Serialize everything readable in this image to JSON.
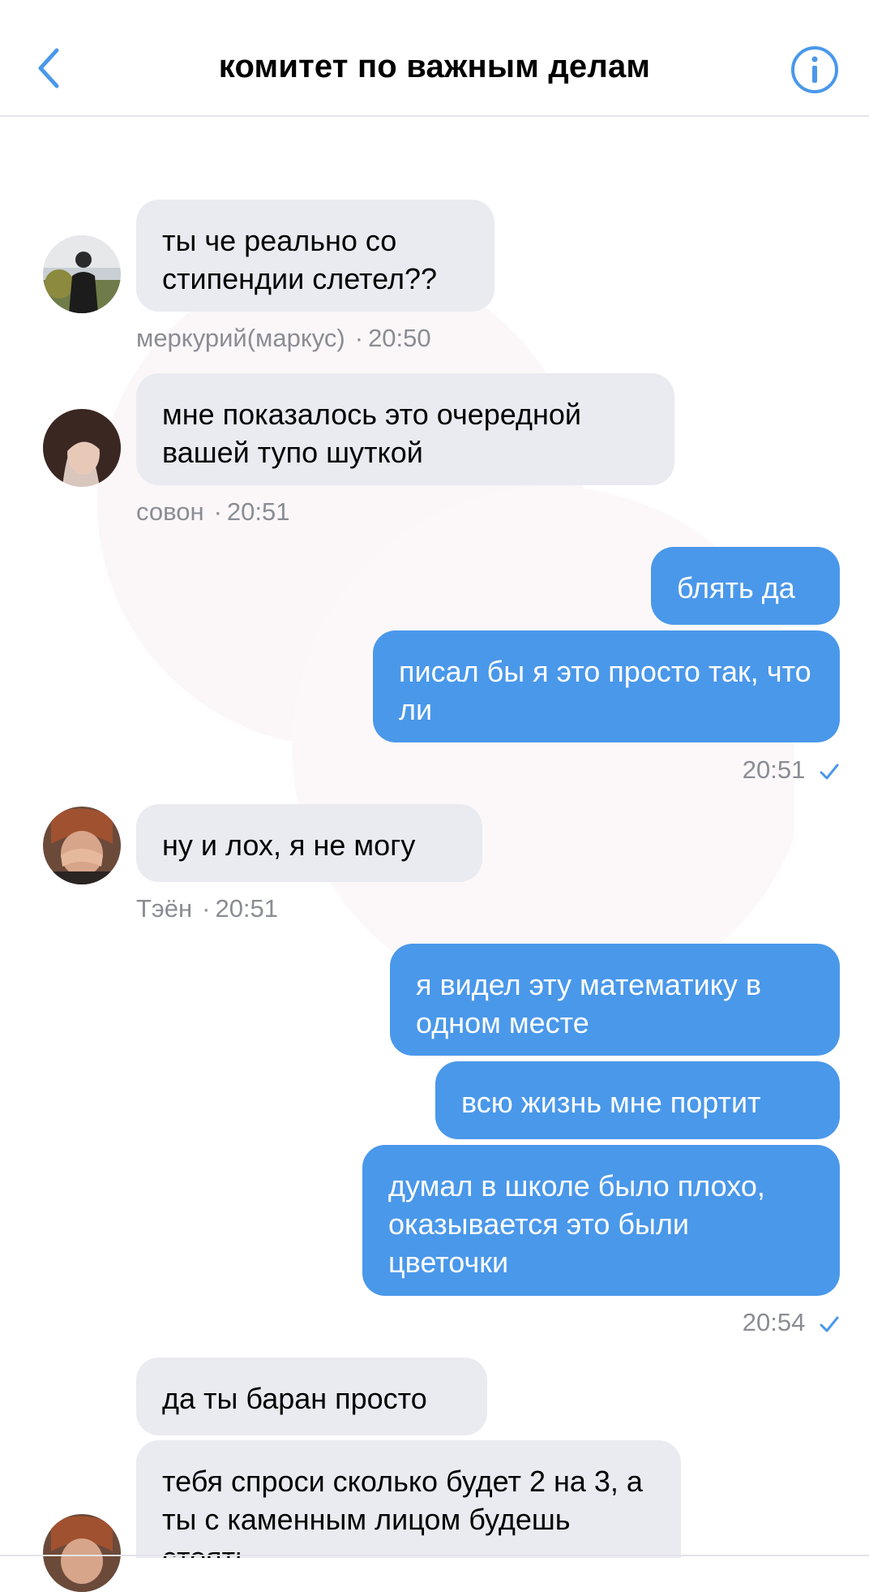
{
  "header": {
    "title": "комитет по важным делам",
    "back_icon": "chevron-left-icon",
    "info_icon": "info-icon"
  },
  "colors": {
    "accent": "#4a98ea",
    "incoming_bubble": "#e9ebf0",
    "meta_text": "#8a8d93"
  },
  "messages": [
    {
      "direction": "in",
      "text": "ты че реально со стипендии слетел??",
      "sender": "меркурий(маркус)",
      "time": "20:50"
    },
    {
      "direction": "in",
      "text": "мне показалось это очередной вашей тупо шуткой",
      "sender": "совон",
      "time": "20:51"
    },
    {
      "direction": "out",
      "text": "блять да"
    },
    {
      "direction": "out",
      "text": "писал бы я это просто так, что ли",
      "time": "20:51"
    },
    {
      "direction": "in",
      "text": "ну и лох, я не могу",
      "sender": "Тэён",
      "time": "20:51"
    },
    {
      "direction": "out",
      "text": "я видел эту математику в одном месте"
    },
    {
      "direction": "out",
      "text": "всю жизнь мне портит"
    },
    {
      "direction": "out",
      "text": "думал в школе было плохо, оказывается это были цветочки",
      "time": "20:54"
    },
    {
      "direction": "in",
      "text": "да ты баран просто"
    },
    {
      "direction": "in",
      "text": "тебя спроси сколько будет 2 на 3, а ты с каменным лицом будешь стоять"
    }
  ]
}
